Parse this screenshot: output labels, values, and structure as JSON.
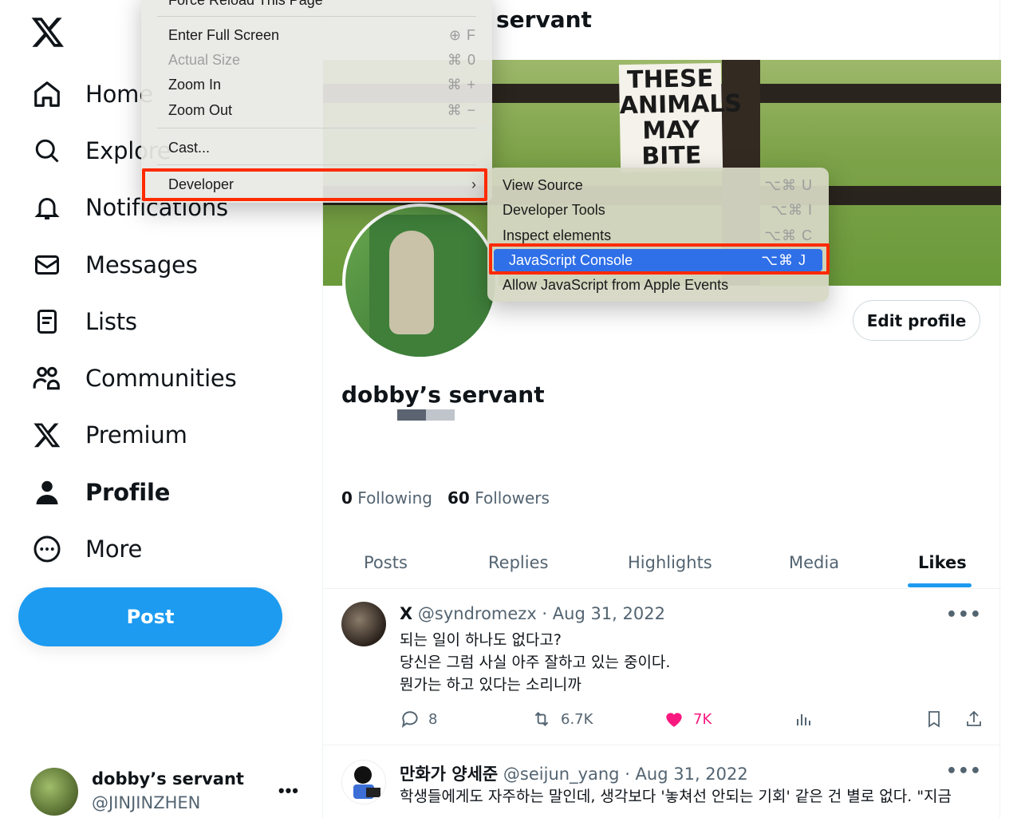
{
  "sidebar": {
    "nav": [
      {
        "label": "Home",
        "icon": "home-icon"
      },
      {
        "label": "Explore",
        "icon": "search-icon"
      },
      {
        "label": "Notifications",
        "icon": "bell-icon"
      },
      {
        "label": "Messages",
        "icon": "mail-icon"
      },
      {
        "label": "Lists",
        "icon": "list-icon"
      },
      {
        "label": "Communities",
        "icon": "people-icon"
      },
      {
        "label": "Premium",
        "icon": "x-logo-icon"
      },
      {
        "label": "Profile",
        "icon": "person-icon"
      },
      {
        "label": "More",
        "icon": "more-circle-icon"
      }
    ],
    "post_label": "Post",
    "account": {
      "name": "dobby’s servant",
      "handle": "@JINJINZHEN"
    }
  },
  "profile": {
    "header_title": "servant",
    "banner_sign": "THESE ANIMALS MAY BITE",
    "edit_label": "Edit profile",
    "display_name": "dobby’s servant",
    "following_count": "0",
    "following_label": "Following",
    "followers_count": "60",
    "followers_label": "Followers",
    "tabs": [
      "Posts",
      "Replies",
      "Highlights",
      "Media",
      "Likes"
    ],
    "active_tab": "Likes"
  },
  "tweets": [
    {
      "name": "X",
      "handle": "@syndromezx",
      "date": "Aug 31, 2022",
      "text": "되는 일이 하나도 없다고?\n당신은 그럼 사실 아주 잘하고 있는 중이다.\n뭔가는 하고 있다는 소리니까",
      "replies": "8",
      "retweets": "6.7K",
      "likes": "7K"
    },
    {
      "name": "만화가 양세준",
      "handle": "@seijun_yang",
      "date": "Aug 31, 2022",
      "text": "학생들에게도 자주하는 말인데, 생각보다 '놓쳐선 안되는 기회' 같은 건 별로 없다. \"지금"
    }
  ],
  "view_menu": {
    "top_item": "Force Reload This Page",
    "items": [
      {
        "label": "Enter Full Screen",
        "shortcut": "⊕ F"
      },
      {
        "label": "Actual Size",
        "shortcut": "⌘ 0",
        "disabled": true
      },
      {
        "label": "Zoom In",
        "shortcut": "⌘ +"
      },
      {
        "label": "Zoom Out",
        "shortcut": "⌘ −"
      },
      {
        "label": "Cast...",
        "shortcut": ""
      },
      {
        "label": "Developer",
        "shortcut": ""
      }
    ]
  },
  "developer_menu": {
    "items": [
      {
        "label": "View Source",
        "shortcut": "⌥⌘ U"
      },
      {
        "label": "Developer Tools",
        "shortcut": "⌥⌘ I"
      },
      {
        "label": "Inspect elements",
        "shortcut": "⌥⌘ C"
      },
      {
        "label": "JavaScript Console",
        "shortcut": "⌥⌘ J"
      },
      {
        "label": "Allow JavaScript from Apple Events",
        "shortcut": ""
      }
    ]
  },
  "colors": {
    "accent": "#1d9bf0",
    "like": "#f91880",
    "menu_highlight": "#2f6fe8",
    "annotation": "#ff2a00"
  }
}
